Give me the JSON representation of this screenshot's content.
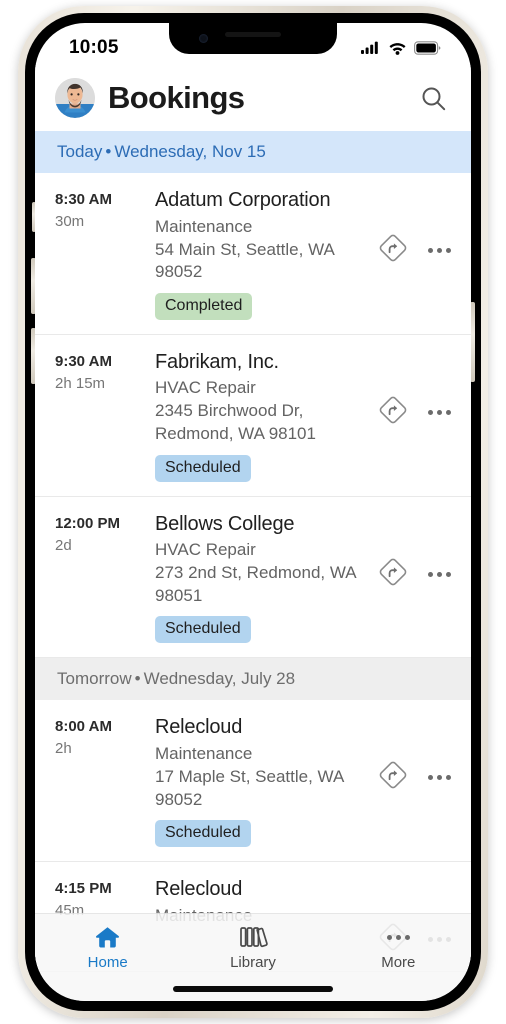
{
  "status_bar": {
    "time": "10:05",
    "icons": [
      "cellular-signal-icon",
      "wifi-icon",
      "battery-icon"
    ]
  },
  "header": {
    "title": "Bookings",
    "avatar_name": "user-avatar",
    "search_icon": "search-icon"
  },
  "colors": {
    "accent_blue": "#1a7ac7",
    "today_band_bg": "#d4e6fa",
    "today_band_text": "#2c6cb5",
    "tomorrow_band_bg": "#eeeeee",
    "tomorrow_band_text": "#6d6d6d",
    "badge_completed_bg": "#c2dfbd",
    "badge_scheduled_bg": "#b2d4ef",
    "frame": "#e8e2d8"
  },
  "sections": [
    {
      "day_label": "Today",
      "separator": "•",
      "date_label": "Wednesday, Nov 15",
      "style": "today",
      "bookings": [
        {
          "time": "8:30 AM",
          "duration": "30m",
          "name": "Adatum Corporation",
          "service": "Maintenance",
          "address": "54 Main St, Seattle, WA 98052",
          "status": "Completed",
          "status_style": "completed",
          "directions_icon": "directions-icon",
          "more_icon": "more-options-icon"
        },
        {
          "time": "9:30 AM",
          "duration": "2h 15m",
          "name": "Fabrikam, Inc.",
          "service": "HVAC Repair",
          "address": "2345 Birchwood Dr, Redmond, WA 98101",
          "status": "Scheduled",
          "status_style": "scheduled",
          "directions_icon": "directions-icon",
          "more_icon": "more-options-icon"
        },
        {
          "time": "12:00 PM",
          "duration": "2d",
          "name": "Bellows College",
          "service": "HVAC Repair",
          "address": "273 2nd St, Redmond, WA 98051",
          "status": "Scheduled",
          "status_style": "scheduled",
          "directions_icon": "directions-icon",
          "more_icon": "more-options-icon"
        }
      ]
    },
    {
      "day_label": "Tomorrow",
      "separator": "•",
      "date_label": "Wednesday, July 28",
      "style": "tomorrow",
      "bookings": [
        {
          "time": "8:00 AM",
          "duration": "2h",
          "name": "Relecloud",
          "service": "Maintenance",
          "address": "17 Maple St, Seattle, WA 98052",
          "status": "Scheduled",
          "status_style": "scheduled",
          "directions_icon": "directions-icon",
          "more_icon": "more-options-icon"
        },
        {
          "time": "4:15 PM",
          "duration": "45m",
          "name": "Relecloud",
          "service": "Maintenance",
          "address": "",
          "status": "",
          "status_style": "scheduled",
          "directions_icon": "directions-icon",
          "more_icon": "more-options-icon"
        }
      ]
    }
  ],
  "tab_bar": {
    "items": [
      {
        "label": "Home",
        "icon": "home-icon",
        "active": true
      },
      {
        "label": "Library",
        "icon": "library-books-icon",
        "active": false
      },
      {
        "label": "More",
        "icon": "more-dots-icon",
        "active": false
      }
    ]
  }
}
